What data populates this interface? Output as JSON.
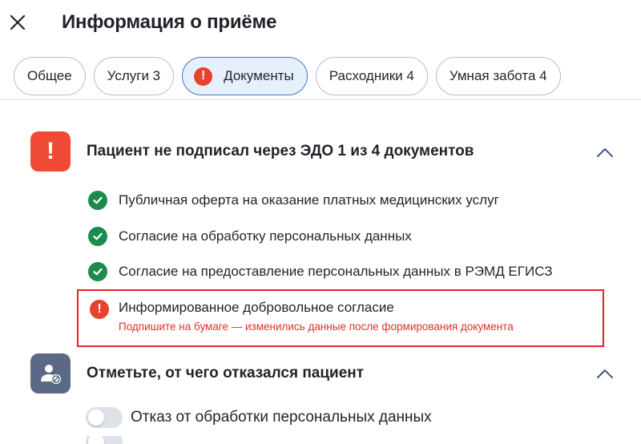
{
  "header": {
    "title": "Информация о приёме",
    "close_icon": "close-icon"
  },
  "tabs": [
    {
      "label": "Общее"
    },
    {
      "label": "Услуги 3"
    },
    {
      "label": "Документы",
      "active": true,
      "alert_icon": "exclamation-icon",
      "alert_glyph": "!"
    },
    {
      "label": "Расходники 4"
    },
    {
      "label": "Умная забота 4"
    }
  ],
  "documents_section": {
    "icon": "warning-icon",
    "icon_glyph": "!",
    "title": "Пациент не подписал через ЭДО 1 из 4 документов",
    "expanded": true,
    "items": [
      {
        "label": "Публичная оферта на оказание платных медицинских услуг",
        "status": "signed"
      },
      {
        "label": "Согласие на обработку персональных данных",
        "status": "signed"
      },
      {
        "label": "Согласие на предоставление персональных данных в РЭМД ЕГИСЗ",
        "status": "signed"
      }
    ],
    "error_item": {
      "label": "Информированное добровольное согласие",
      "status": "error",
      "glyph": "!",
      "message": "Подпишите на бумаге — изменились данные после формирования документа"
    }
  },
  "refusal_section": {
    "icon": "user-blocked-icon",
    "title": "Отметьте, от чего отказался пациент",
    "expanded": true,
    "toggles": [
      {
        "label": "Отказ от обработки персональных данных",
        "checked": false
      }
    ]
  },
  "colors": {
    "accent": "#3d77c6",
    "active_tab_bg": "#e6f0fb",
    "error": "#e0252b",
    "warning": "#ef4a35",
    "success": "#1d8a4e",
    "user_icon_bg": "#5a6a86"
  }
}
